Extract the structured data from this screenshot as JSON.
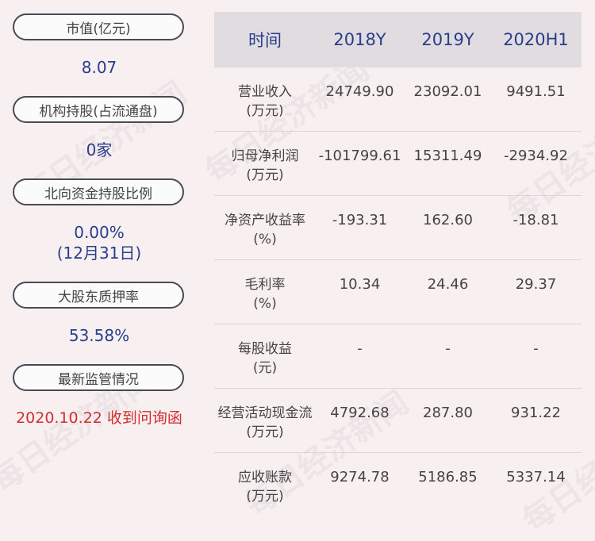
{
  "watermark": "每日经济新闻",
  "sidebar": {
    "market_cap_label": "市值(亿元)",
    "market_cap_value": "8.07",
    "institution_label": "机构持股(占流通盘)",
    "institution_value": "0家",
    "northbound_label": "北向资金持股比例",
    "northbound_value": "0.00%",
    "northbound_date": "(12月31日)",
    "pledge_label": "大股东质押率",
    "pledge_value": "53.58%",
    "regulation_label": "最新监管情况",
    "regulation_value": "2020.10.22 收到问询函"
  },
  "table": {
    "headers": [
      "时间",
      "2018Y",
      "2019Y",
      "2020H1"
    ],
    "rows": [
      {
        "label": "营业收入",
        "unit": "(万元)",
        "values": [
          "24749.90",
          "23092.01",
          "9491.51"
        ]
      },
      {
        "label": "归母净利润",
        "unit": "(万元)",
        "values": [
          "-101799.61",
          "15311.49",
          "-2934.92"
        ]
      },
      {
        "label": "净资产收益率",
        "unit": "(%)",
        "values": [
          "-193.31",
          "162.60",
          "-18.81"
        ]
      },
      {
        "label": "毛利率",
        "unit": "(%)",
        "values": [
          "10.34",
          "24.46",
          "29.37"
        ]
      },
      {
        "label": "每股收益",
        "unit": "(元)",
        "values": [
          "-",
          "-",
          "-"
        ]
      },
      {
        "label": "经营活动现金流",
        "unit": "(万元)",
        "values": [
          "4792.68",
          "287.80",
          "931.22"
        ]
      },
      {
        "label": "应收账款",
        "unit": "(万元)",
        "values": [
          "9274.78",
          "5186.85",
          "5337.14"
        ]
      }
    ]
  }
}
